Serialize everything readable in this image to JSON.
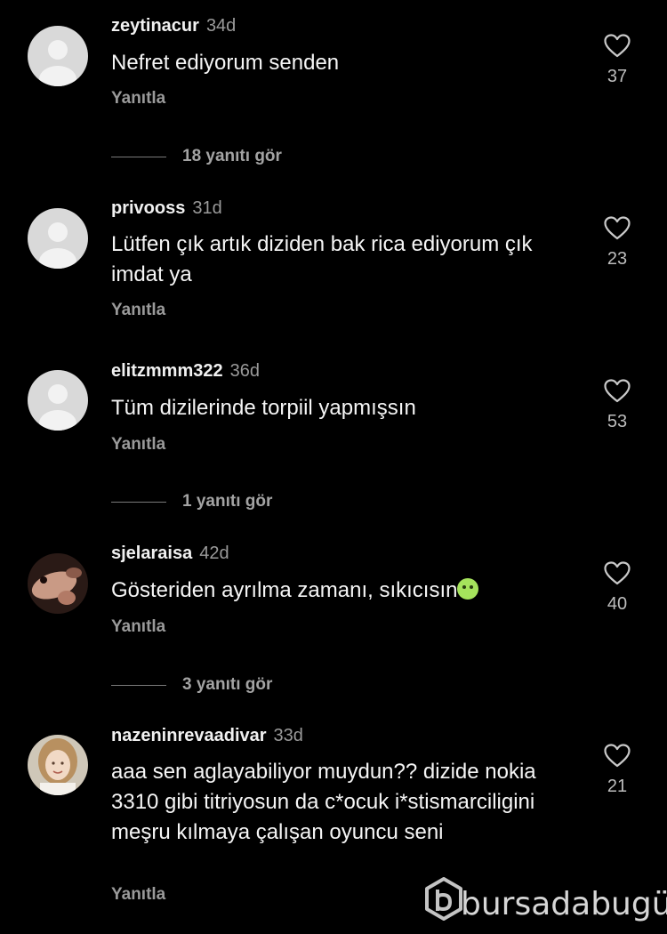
{
  "comments": [
    {
      "username": "zeytinacur",
      "age": "34d",
      "text": "Nefret ediyorum senden",
      "reply_label": "Yanıtla",
      "likes": "37",
      "avatar": "default-avatar"
    },
    {
      "username": "privooss",
      "age": "31d",
      "text": "Lütfen çık artık diziden bak rica ediyorum çık imdat ya",
      "reply_label": "Yanıtla",
      "likes": "23",
      "avatar": "default-avatar"
    },
    {
      "username": "elitzmmm322",
      "age": "36d",
      "text": "Tüm dizilerinde torpiil yapmışsın",
      "reply_label": "Yanıtla",
      "likes": "53",
      "avatar": "default-avatar"
    },
    {
      "username": "sjelaraisa",
      "age": "42d",
      "text": "Gösteriden ayrılma zamanı, sıkıcısın",
      "emoji": "nauseated-face-emoji",
      "reply_label": "Yanıtla",
      "likes": "40",
      "avatar": "photo-avatar"
    },
    {
      "username": "nazeninrevaadivar",
      "age": "33d",
      "text": "aaa sen aglayabiliyor muydun?? dizide nokia 3310 gibi titriyosun da c*ocuk i*stismarciligini meşru kılmaya çalışan oyuncu seni",
      "reply_label": "Yanıtla",
      "likes": "21",
      "avatar": "photo-avatar"
    }
  ],
  "view_replies": [
    {
      "label": "18 yanıtı gör"
    },
    {
      "label": "1 yanıtı gör"
    },
    {
      "label": "3 yanıtı gör"
    }
  ],
  "icons": {
    "like": "heart-outline-icon"
  },
  "watermark": {
    "text": "bursadabugün"
  },
  "colors": {
    "background": "#000000",
    "text": "#f5f5f5",
    "secondary_text": "#9a9a9a",
    "default_avatar": "#d9d9d9"
  }
}
